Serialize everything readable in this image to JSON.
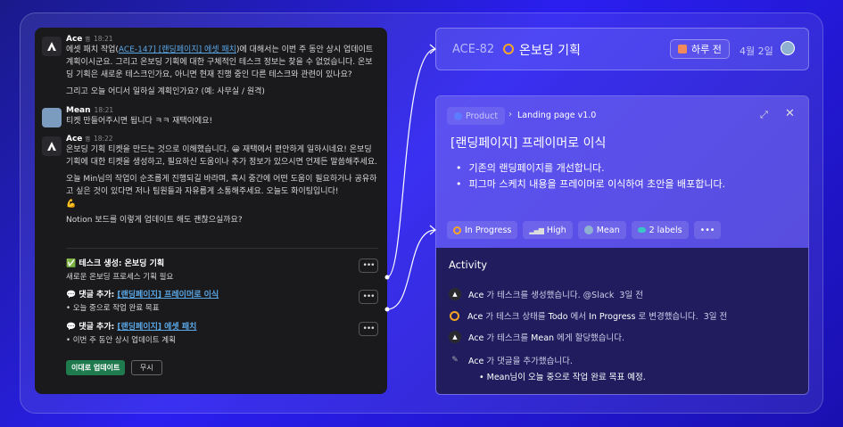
{
  "slack": {
    "m1": {
      "user": "Ace",
      "badge": "앱",
      "time": "18:21",
      "pre": "에셋 패치 작업(",
      "link": "ACE-147] [랜딩페이지] 에셋 패치",
      "post": ")에 대해서는 이번 주 동안 상시 업데이트 계획이시군요. 그리고 온보딩 기획에 대한 구체적인 테스크 정보는 찾을 수 없었습니다. 온보딩 기획은 새로운 테스크인가요, 아니면 현재 진행 중인 다른 테스크와 관련이 있나요?",
      "line2": "그리고 오늘 어디서 일하실 계획인가요? (예: 사무실 / 원격)"
    },
    "m2": {
      "user": "Mean",
      "time": "18:21",
      "text": "티켓 만들어주시면 됩니다 ㅋㅋ 재택이에요!"
    },
    "m3": {
      "user": "Ace",
      "badge": "앱",
      "time": "18:22",
      "p1a": "온보딩 기획 티켓을 만드는 것으로 이해했습니다.",
      "emoji1": "😀",
      "p1b": "재택에서 편안하게 일하시네요! 온보딩 기획에 대한 티켓을 생성하고, 필요하신 도움이나 추가 정보가 있으시면 언제든 말씀해주세요.",
      "p2": "오늘 Min님의 작업이 순조롭게 진행되길 바라며, 혹시 중간에 어떤 도움이 필요하거나 공유하고 싶은 것이 있다면 저나 팀원들과 자유롭게 소통해주세요. 오늘도 화이팅입니다!",
      "emoji2": "💪",
      "p3": "Notion 보드를 이렇게 업데이트 해도 괜찮으실까요?"
    },
    "tasks": [
      {
        "icon": "✅",
        "label": "테스크 생성: 온보딩 기획",
        "link": "",
        "sub": "새로운 온보딩 프로세스 기획 필요"
      },
      {
        "icon": "💬",
        "label": "댓글 추가: ",
        "link": "[랜딩페이지] 프레이머로 이식",
        "sub": "• 오늘 중으로 작업 완료 목표"
      },
      {
        "icon": "💬",
        "label": "댓글 추가: ",
        "link": "[랜딩페이지] 에셋 패치",
        "sub": "• 이번 주 동안 상시 업데이트 계획"
      }
    ],
    "dots": "•••",
    "update_button": "이대로 업데이트",
    "ignore_button": "무시"
  },
  "issue": {
    "id": "ACE-82",
    "title": "온보딩 기획",
    "due": "하루 전",
    "date": "4월 2일"
  },
  "detail": {
    "crumb_product": "Product",
    "crumb_sep": "›",
    "crumb_project": "Landing page v1.0",
    "expand": "⤢",
    "close": "✕",
    "title": "[랜딩페이지] 프레이머로 이식",
    "bullets": [
      "기존의 랜딩페이지를 개선합니다.",
      "피그마 스케치 내용을 프레이머로 이식하여 초안을 배포합니다."
    ],
    "props": {
      "status": "In Progress",
      "priority": "High",
      "assignee": "Mean",
      "labels": "2 labels",
      "more": "•••"
    },
    "activity_title": "Activity",
    "activity": [
      {
        "actor": "Ace",
        "text": " 가 테스크를 생성했습니다. @Slack",
        "time": "3일 전"
      },
      {
        "actor": "Ace",
        "text1": " 가 테스크 상태를 ",
        "from": "Todo",
        "text2": " 에서 ",
        "to": "In Progress",
        "text3": " 로 변경했습니다.",
        "time": "3일 전"
      },
      {
        "actor": "Ace",
        "text1": " 가 테스크를 ",
        "who": "Mean",
        "text2": " 에게 할당했습니다."
      },
      {
        "actor": "Ace",
        "text": " 가 댓글을 추가했습니다."
      }
    ],
    "comment": "• Mean님이 오늘 중으로 작업 완료 목표 예정."
  },
  "colors": {
    "accent": "#2a1ff0",
    "status": "#f5a623",
    "slack_bg": "#1a1a1d",
    "button_green": "#1f7a4d"
  }
}
